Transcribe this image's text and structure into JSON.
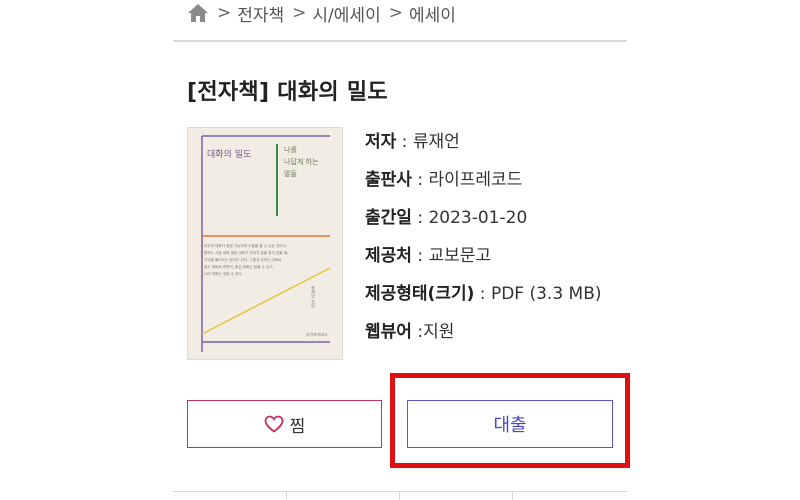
{
  "breadcrumb": {
    "home_icon": "home-icon",
    "items": [
      "전자책",
      "시/에세이",
      "에세이"
    ],
    "separator": ">"
  },
  "book": {
    "title": "[전자책] 대화의 밀도",
    "cover": {
      "title": "대화의 밀도",
      "subtitle_lines": [
        "나를",
        "나답게 하는",
        "말들"
      ],
      "body_lines": [
        "마주의 대화가 점점 가능하게 도움을 줄 수 있는 것이다.",
        "원하는 사람 대화 밀한 대화가 우리가 말을 찾지 않을 때,",
        "기억을 불러오는 정서도 있다. 그렇게 우리는 대화로",
        "쉽고 대화로 하면서, 좋은 대화는 말을 수 있고,",
        "나의 대화는 생명 수 있다."
      ],
      "author": "류재언 지음",
      "publisher": "라이프레코드"
    },
    "meta": [
      {
        "label": "저자",
        "value": "류재언",
        "sep": " : "
      },
      {
        "label": "출판사",
        "value": "라이프레코드",
        "sep": " : "
      },
      {
        "label": "출간일",
        "value": "2023-01-20",
        "sep": " : "
      },
      {
        "label": "제공처",
        "value": "교보문고",
        "sep": " : "
      },
      {
        "label": "제공형태(크기)",
        "value": "PDF (3.3 MB)",
        "sep": " : "
      },
      {
        "label": "웹뷰어",
        "value": "지원",
        "sep": " :"
      }
    ]
  },
  "actions": {
    "wish_label": "찜",
    "wish_icon": "heart-outline-icon",
    "loan_label": "대출"
  },
  "colors": {
    "wish_border": "#c2305f",
    "loan_border": "#5b55cf",
    "loan_text": "#4b45c9",
    "highlight": "#e01010"
  }
}
